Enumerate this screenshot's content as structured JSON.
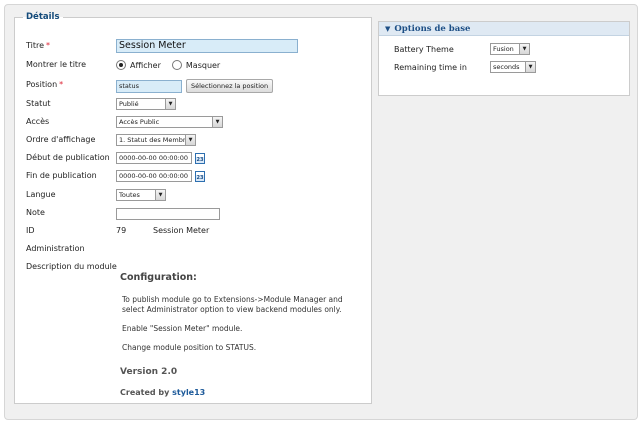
{
  "details": {
    "legend": "Détails",
    "required_mark": "*",
    "fields": {
      "title": {
        "label": "Titre",
        "value": "Session Meter"
      },
      "show_title": {
        "label": "Montrer le titre",
        "options": [
          "Afficher",
          "Masquer"
        ],
        "selected": "Afficher"
      },
      "position": {
        "label": "Position",
        "value": "status",
        "button": "Sélectionnez la position"
      },
      "status": {
        "label": "Statut",
        "value": "Publié"
      },
      "access": {
        "label": "Accès",
        "value": "Accès Public"
      },
      "ordering": {
        "label": "Ordre d'affichage",
        "value": "1. Statut des Membres"
      },
      "publish_up": {
        "label": "Début de publication",
        "value": "0000-00-00 00:00:00"
      },
      "publish_down": {
        "label": "Fin de publication",
        "value": "0000-00-00 00:00:00"
      },
      "language": {
        "label": "Langue",
        "value": "Toutes"
      },
      "note": {
        "label": "Note",
        "value": ""
      },
      "id": {
        "label": "ID",
        "value": "79",
        "name": "Session Meter"
      },
      "administration": {
        "label": "Administration"
      },
      "description": {
        "label": "Description du module"
      }
    },
    "calendar_icon_text": "23",
    "module_description": {
      "heading": "Configuration:",
      "paragraphs": [
        "To publish module go to Extensions->Module Manager and select Administrator option to view backend modules only.",
        "Enable \"Session Meter\" module.",
        "Change module position to STATUS."
      ],
      "version": "Version 2.0",
      "created_by_prefix": "Created by",
      "created_by_link": "style13"
    }
  },
  "basic_options": {
    "header": "Options de base",
    "fields": [
      {
        "label": "Battery Theme",
        "value": "Fusion"
      },
      {
        "label": "Remaining time in",
        "value": "seconds"
      }
    ]
  },
  "colors": {
    "accent": "#1d4f86",
    "required": "#dd2233",
    "input_highlight": "#d8ecf8"
  }
}
